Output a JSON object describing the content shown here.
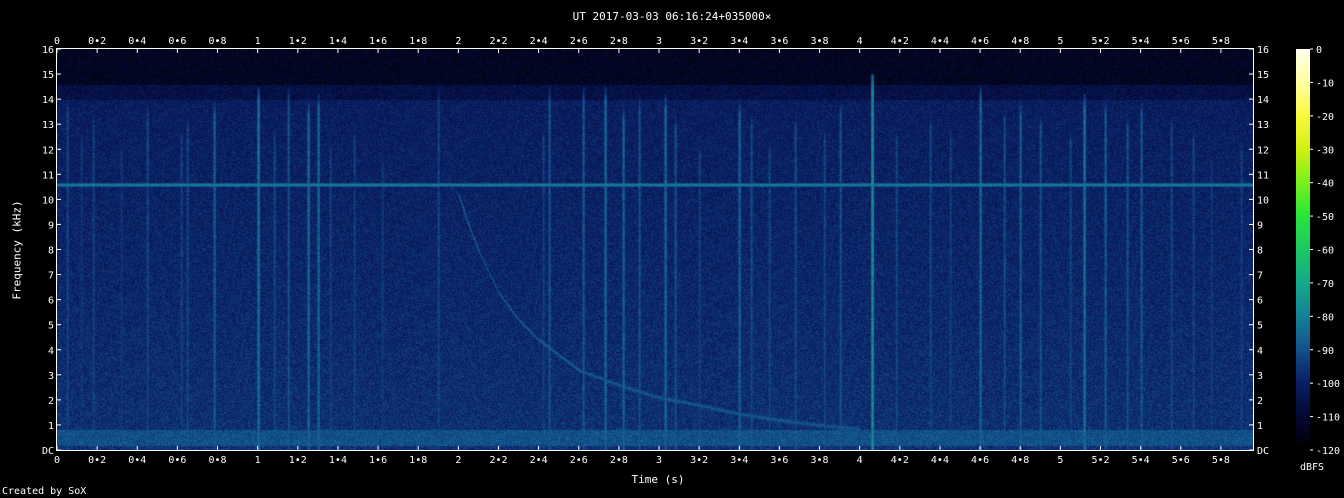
{
  "header": {
    "title": "UT 2017-03-03 06:16:24+035000×"
  },
  "footer": {
    "credit": "Created by SoX"
  },
  "chart_data": {
    "type": "heatmap",
    "title": "UT 2017-03-03 06:16:24+035000×",
    "xlabel": "Time (s)",
    "ylabel": "Frequency (kHz)",
    "xlim": [
      0,
      5.96
    ],
    "ylim": [
      0,
      16
    ],
    "x_ticks": [
      "0",
      "0•2",
      "0•4",
      "0•6",
      "0•8",
      "1",
      "1•2",
      "1•4",
      "1•6",
      "1•8",
      "2",
      "2•2",
      "2•4",
      "2•6",
      "2•8",
      "3",
      "3•2",
      "3•4",
      "3•6",
      "3•8",
      "4",
      "4•2",
      "4•4",
      "4•6",
      "4•8",
      "5",
      "5•2",
      "5•4",
      "5•6",
      "5•8"
    ],
    "x_tick_values": [
      0,
      0.2,
      0.4,
      0.6,
      0.8,
      1,
      1.2,
      1.4,
      1.6,
      1.8,
      2,
      2.2,
      2.4,
      2.6,
      2.8,
      3,
      3.2,
      3.4,
      3.6,
      3.8,
      4,
      4.2,
      4.4,
      4.6,
      4.8,
      5,
      5.2,
      5.4,
      5.6,
      5.8
    ],
    "y_ticks": [
      "DC",
      "1",
      "2",
      "3",
      "4",
      "5",
      "6",
      "7",
      "8",
      "9",
      "10",
      "11",
      "12",
      "13",
      "14",
      "15",
      "16"
    ],
    "y_tick_values": [
      0,
      1,
      2,
      3,
      4,
      5,
      6,
      7,
      8,
      9,
      10,
      11,
      12,
      13,
      14,
      15,
      16
    ],
    "colorbar": {
      "label": "dBFS",
      "ticks": [
        "0",
        "-10",
        "-20",
        "-30",
        "-40",
        "-50",
        "-60",
        "-70",
        "-80",
        "-90",
        "-100",
        "-110",
        "-120"
      ],
      "tick_values": [
        0,
        -10,
        -20,
        -30,
        -40,
        -50,
        -60,
        -70,
        -80,
        -90,
        -100,
        -110,
        -120
      ],
      "range": [
        -120,
        0
      ]
    },
    "features": {
      "tone_line_khz": 10.6,
      "low_band_khz": [
        0.2,
        0.8
      ],
      "whistler": [
        [
          2.0,
          10.2
        ],
        [
          2.05,
          9.0
        ],
        [
          2.1,
          8.0
        ],
        [
          2.2,
          6.3
        ],
        [
          2.3,
          5.2
        ],
        [
          2.4,
          4.4
        ],
        [
          2.5,
          3.8
        ],
        [
          2.6,
          3.2
        ],
        [
          2.8,
          2.6
        ],
        [
          3.0,
          2.1
        ],
        [
          3.2,
          1.8
        ],
        [
          3.4,
          1.45
        ],
        [
          3.6,
          1.2
        ],
        [
          3.8,
          1.0
        ],
        [
          4.0,
          0.85
        ]
      ],
      "sferics": [
        {
          "t": 0.05,
          "top": 14.2,
          "db": -92
        },
        {
          "t": 0.12,
          "top": 13.0,
          "db": -95
        },
        {
          "t": 0.18,
          "top": 13.5,
          "db": -93
        },
        {
          "t": 0.32,
          "top": 12.5,
          "db": -95
        },
        {
          "t": 0.45,
          "top": 14.0,
          "db": -92
        },
        {
          "t": 0.62,
          "top": 13.0,
          "db": -93
        },
        {
          "t": 0.65,
          "top": 13.5,
          "db": -92
        },
        {
          "t": 0.78,
          "top": 14.0,
          "db": -88
        },
        {
          "t": 1.0,
          "top": 14.5,
          "db": -84
        },
        {
          "t": 1.08,
          "top": 13.0,
          "db": -92
        },
        {
          "t": 1.15,
          "top": 14.5,
          "db": -90
        },
        {
          "t": 1.25,
          "top": 14.0,
          "db": -86
        },
        {
          "t": 1.3,
          "top": 14.2,
          "db": -86
        },
        {
          "t": 1.36,
          "top": 12.5,
          "db": -93
        },
        {
          "t": 1.48,
          "top": 13.0,
          "db": -93
        },
        {
          "t": 1.62,
          "top": 12.0,
          "db": -94
        },
        {
          "t": 1.9,
          "top": 14.5,
          "db": -92
        },
        {
          "t": 2.42,
          "top": 13.0,
          "db": -93
        },
        {
          "t": 2.45,
          "top": 14.5,
          "db": -90
        },
        {
          "t": 2.62,
          "top": 14.5,
          "db": -89
        },
        {
          "t": 2.73,
          "top": 14.5,
          "db": -86
        },
        {
          "t": 2.82,
          "top": 13.8,
          "db": -87
        },
        {
          "t": 2.9,
          "top": 14.2,
          "db": -90
        },
        {
          "t": 3.03,
          "top": 14.2,
          "db": -86
        },
        {
          "t": 3.08,
          "top": 13.5,
          "db": -90
        },
        {
          "t": 3.2,
          "top": 12.5,
          "db": -93
        },
        {
          "t": 3.4,
          "top": 14.0,
          "db": -87
        },
        {
          "t": 3.46,
          "top": 13.5,
          "db": -91
        },
        {
          "t": 3.55,
          "top": 12.5,
          "db": -92
        },
        {
          "t": 3.68,
          "top": 13.5,
          "db": -91
        },
        {
          "t": 3.82,
          "top": 13.0,
          "db": -92
        },
        {
          "t": 3.9,
          "top": 14.0,
          "db": -90
        },
        {
          "t": 4.06,
          "top": 15.0,
          "db": -78
        },
        {
          "t": 4.18,
          "top": 13.0,
          "db": -92
        },
        {
          "t": 4.35,
          "top": 13.5,
          "db": -92
        },
        {
          "t": 4.45,
          "top": 13.0,
          "db": -93
        },
        {
          "t": 4.6,
          "top": 14.5,
          "db": -86
        },
        {
          "t": 4.72,
          "top": 13.8,
          "db": -91
        },
        {
          "t": 4.8,
          "top": 14.0,
          "db": -88
        },
        {
          "t": 4.9,
          "top": 13.5,
          "db": -90
        },
        {
          "t": 5.05,
          "top": 13.0,
          "db": -92
        },
        {
          "t": 5.12,
          "top": 14.2,
          "db": -84
        },
        {
          "t": 5.22,
          "top": 14.0,
          "db": -88
        },
        {
          "t": 5.33,
          "top": 13.5,
          "db": -90
        },
        {
          "t": 5.4,
          "top": 14.0,
          "db": -89
        },
        {
          "t": 5.55,
          "top": 13.5,
          "db": -92
        },
        {
          "t": 5.66,
          "top": 13.0,
          "db": -92
        },
        {
          "t": 5.75,
          "top": 12.0,
          "db": -94
        },
        {
          "t": 5.9,
          "top": 12.5,
          "db": -93
        }
      ]
    }
  }
}
